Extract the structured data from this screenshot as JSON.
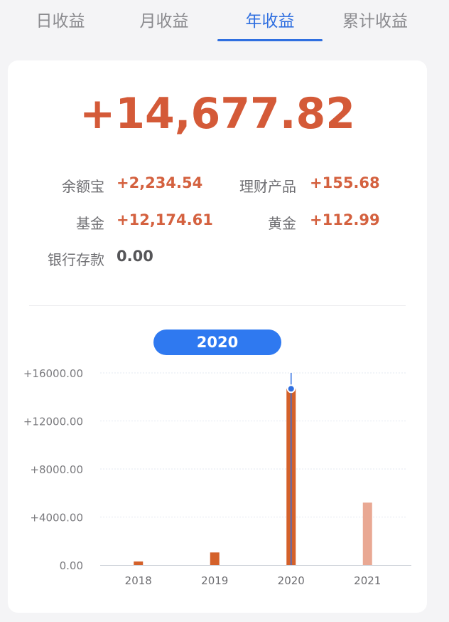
{
  "tabs": [
    {
      "label": "日收益",
      "active": false
    },
    {
      "label": "月收益",
      "active": false
    },
    {
      "label": "年收益",
      "active": true
    },
    {
      "label": "累计收益",
      "active": false
    }
  ],
  "summary": {
    "total": "+14,677.82",
    "items": [
      {
        "label": "余额宝",
        "value": "+2,234.54"
      },
      {
        "label": "理财产品",
        "value": "+155.68"
      },
      {
        "label": "基金",
        "value": "+12,174.61"
      },
      {
        "label": "黄金",
        "value": "+112.99"
      },
      {
        "label": "银行存款",
        "value": "0.00"
      }
    ]
  },
  "selected_year": "2020",
  "colors": {
    "accent": "#2f6fe0",
    "positive": "#d45a38",
    "bar": "#d4612a",
    "bar_future": "#e9a893"
  },
  "chart_data": {
    "type": "bar",
    "categories": [
      "2018",
      "2019",
      "2020",
      "2021"
    ],
    "values": [
      300,
      1050,
      14677.82,
      5200
    ],
    "y_tick_labels": [
      "0.00",
      "+4000.00",
      "+8000.00",
      "+12000.00",
      "+16000.00"
    ],
    "ylim": [
      0,
      16000
    ],
    "grid": true,
    "highlighted": "2020"
  }
}
